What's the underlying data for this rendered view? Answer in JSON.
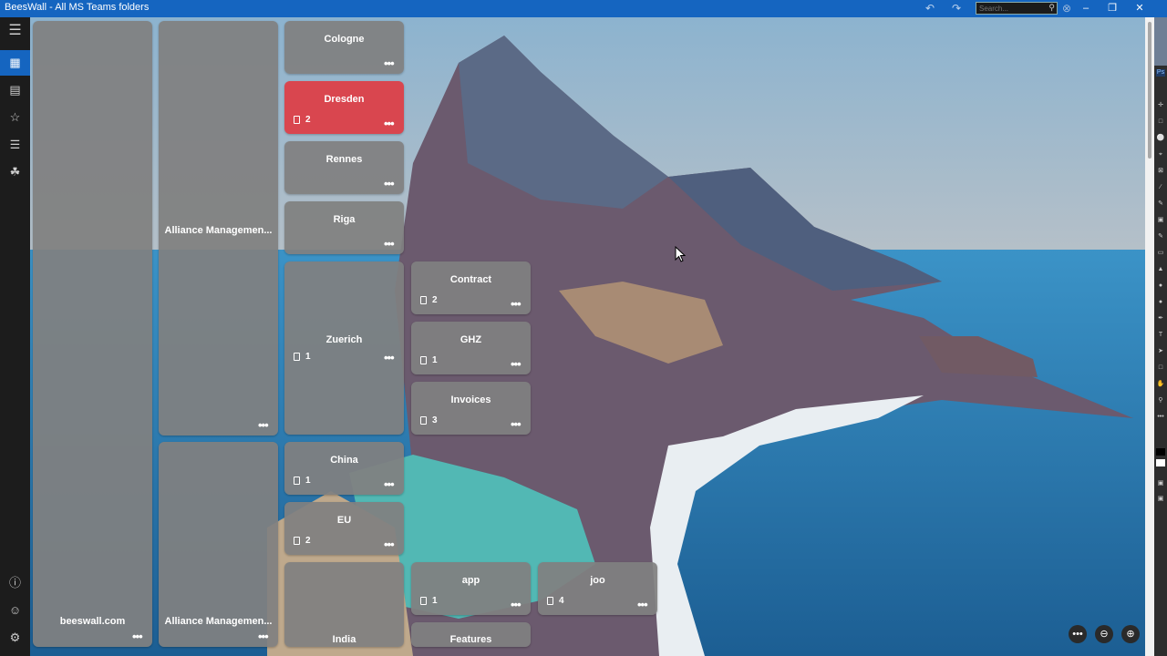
{
  "window": {
    "title": "BeesWall - All MS Teams folders"
  },
  "toolbar": {
    "undo_icon": "undo-icon",
    "redo_icon": "redo-icon"
  },
  "search": {
    "placeholder": "Search..."
  },
  "rail": {
    "items": [
      {
        "icon": "hamburger-menu-icon"
      },
      {
        "icon": "wall-grid-icon",
        "active": true
      },
      {
        "icon": "presentation-icon"
      },
      {
        "icon": "star-icon"
      },
      {
        "icon": "list-icon"
      },
      {
        "icon": "tag-icon"
      },
      {
        "icon": "info-icon"
      },
      {
        "icon": "user-icon"
      },
      {
        "icon": "settings-gear-icon"
      }
    ]
  },
  "tiles": [
    {
      "name": "beeswall.com",
      "count": ""
    },
    {
      "name": "Alliance Managemen...",
      "count": ""
    },
    {
      "name": "Alliance Managemen...",
      "count": ""
    },
    {
      "name": "Cologne",
      "count": ""
    },
    {
      "name": "Dresden",
      "count": "2",
      "highlight": "#d9464f"
    },
    {
      "name": "Rennes",
      "count": ""
    },
    {
      "name": "Riga",
      "count": ""
    },
    {
      "name": "Zuerich",
      "count": "1"
    },
    {
      "name": "China",
      "count": "1"
    },
    {
      "name": "EU",
      "count": "2"
    },
    {
      "name": "India",
      "count": ""
    },
    {
      "name": "Contract",
      "count": "2"
    },
    {
      "name": "GHZ",
      "count": "1"
    },
    {
      "name": "Invoices",
      "count": "3"
    },
    {
      "name": "app",
      "count": "1"
    },
    {
      "name": "joo",
      "count": "4"
    },
    {
      "name": "Features",
      "count": ""
    }
  ],
  "zoom": {
    "more_icon": "more-icon",
    "zoom_out_icon": "zoom-out-icon",
    "zoom_in_icon": "zoom-in-icon"
  },
  "colors": {
    "titlebar": "#1565c0",
    "accent": "#1565c0",
    "tile": "#808080",
    "highlight": "#d9464f"
  }
}
